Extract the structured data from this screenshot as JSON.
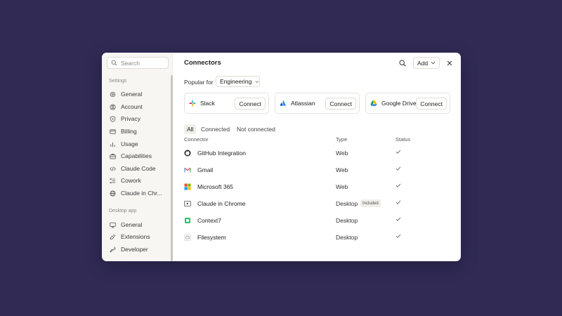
{
  "sidebar": {
    "search_placeholder": "Search",
    "settings_label": "Settings",
    "settings_items": [
      {
        "label": "General",
        "icon": "gear-icon"
      },
      {
        "label": "Account",
        "icon": "user-icon"
      },
      {
        "label": "Privacy",
        "icon": "shield-icon"
      },
      {
        "label": "Billing",
        "icon": "credit-card-icon"
      },
      {
        "label": "Usage",
        "icon": "chart-icon"
      },
      {
        "label": "Capabilities",
        "icon": "briefcase-icon"
      },
      {
        "label": "Claude Code",
        "icon": "code-icon"
      },
      {
        "label": "Cowork",
        "icon": "list-icon"
      },
      {
        "label": "Claude in Chr...",
        "icon": "globe-icon"
      }
    ],
    "desktop_label": "Desktop app",
    "desktop_items": [
      {
        "label": "General",
        "icon": "monitor-icon"
      },
      {
        "label": "Extensions",
        "icon": "plug-icon"
      },
      {
        "label": "Developer",
        "icon": "wrench-icon"
      }
    ]
  },
  "header": {
    "title": "Connectors",
    "add_label": "Add"
  },
  "popular": {
    "label": "Popular for",
    "selected": "Engineering"
  },
  "cards": [
    {
      "name": "Slack",
      "button": "Connect",
      "icon": "slack-icon"
    },
    {
      "name": "Atlassian",
      "button": "Connect",
      "icon": "atlassian-icon"
    },
    {
      "name": "Google Drive",
      "button": "Connect",
      "icon": "google-drive-icon"
    }
  ],
  "filters": [
    "All",
    "Connected",
    "Not connected"
  ],
  "table": {
    "headers": {
      "connector": "Connector",
      "type": "Type",
      "status": "Status"
    },
    "rows": [
      {
        "name": "GitHub Integration",
        "type": "Web",
        "badge": "",
        "icon": "github-icon"
      },
      {
        "name": "Gmail",
        "type": "Web",
        "badge": "",
        "icon": "gmail-icon"
      },
      {
        "name": "Microsoft 365",
        "type": "Web",
        "badge": "",
        "icon": "microsoft-icon"
      },
      {
        "name": "Claude in Chrome",
        "type": "Desktop",
        "badge": "Included",
        "icon": "chrome-extension-icon"
      },
      {
        "name": "Context7",
        "type": "Desktop",
        "badge": "",
        "icon": "context7-icon"
      },
      {
        "name": "Filesystem",
        "type": "Desktop",
        "badge": "",
        "icon": "folder-icon"
      }
    ]
  },
  "colors": {
    "background": "#302a55",
    "sidebar": "#f7f6f3",
    "panel": "#ffffff"
  }
}
